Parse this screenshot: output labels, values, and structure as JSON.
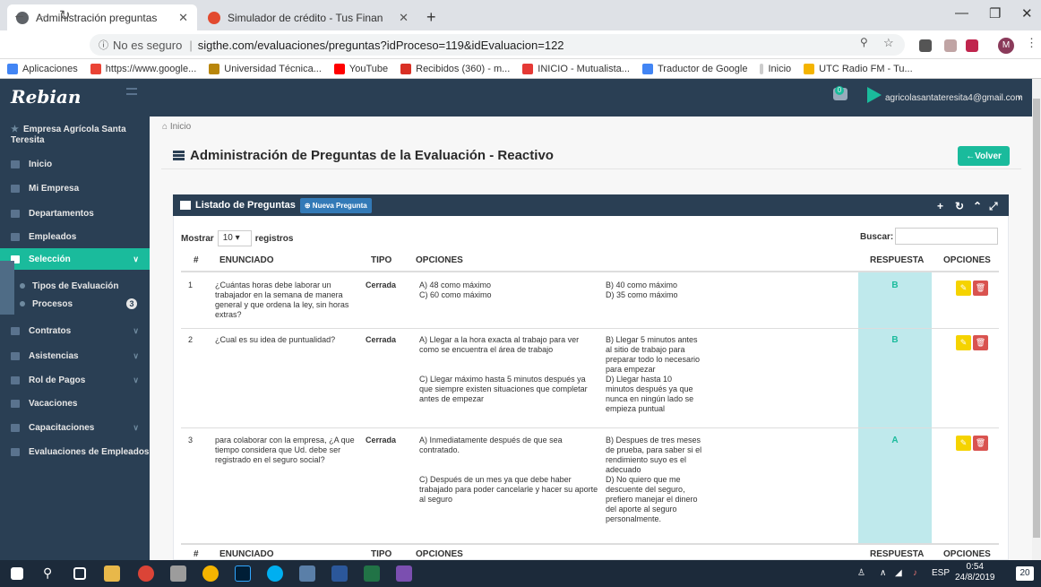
{
  "browser": {
    "tabs": [
      {
        "title": "Administración preguntas",
        "active": true
      },
      {
        "title": "Simulador de crédito - Tus Finan",
        "active": false
      }
    ],
    "security_label": "No es seguro",
    "url": "sigthe.com/evaluaciones/preguntas?idProceso=119&idEvaluacion=122",
    "profile_initial": "M",
    "bookmarks": [
      "Aplicaciones",
      "https://www.google...",
      "Universidad Técnica...",
      "YouTube",
      "Recibidos (360) - m...",
      "INICIO - Mutualista...",
      "Traductor de Google",
      "Inicio",
      "UTC Radio FM - Tu..."
    ]
  },
  "app": {
    "logo": "Rebian",
    "notification_count": "0",
    "user_email": "agricolasantateresita4@gmail.com",
    "company": "Empresa Agrícola Santa Teresita",
    "sidebar": [
      {
        "label": "Inicio",
        "icon": "home-icon"
      },
      {
        "label": "Mi Empresa",
        "icon": "building-icon"
      },
      {
        "label": "Departamentos",
        "icon": "building-icon"
      },
      {
        "label": "Empleados",
        "icon": "users-icon"
      },
      {
        "label": "Selección",
        "icon": "edit-icon",
        "active": true
      },
      {
        "label": "Contratos",
        "icon": "table-icon"
      },
      {
        "label": "Asistencias",
        "icon": "edit-icon"
      },
      {
        "label": "Rol de Pagos",
        "icon": "table-icon"
      },
      {
        "label": "Vacaciones",
        "icon": "plane-icon"
      },
      {
        "label": "Capacitaciones",
        "icon": "table-icon"
      },
      {
        "label": "Evaluaciones de Empleados",
        "icon": "table-icon"
      }
    ],
    "submenu": [
      {
        "label": "Tipos de Evaluación"
      },
      {
        "label": "Procesos",
        "badge": "3"
      }
    ]
  },
  "page": {
    "breadcrumb": "Inicio",
    "title": "Administración de Preguntas de la Evaluación - Reactivo",
    "back_label": "Volver",
    "panel_title": "Listado de Preguntas",
    "new_button": "Nueva Pregunta",
    "show_label": "Mostrar",
    "show_value": "10",
    "records_label": "registros",
    "search_label": "Buscar:",
    "columns": [
      "#",
      "ENUNCIADO",
      "TIPO",
      "OPCIONES",
      "RESPUESTA",
      "OPCIONES"
    ],
    "rows": [
      {
        "num": "1",
        "statement": "¿Cuántas horas debe laborar un trabajador en la semana de manera general y que ordena la ley, sin horas extras?",
        "type": "Cerrada",
        "opt_left": "A) 48 como máximo\nC) 60 como máximo",
        "opt_right": "B) 40 como máximo\nD) 35 como máximo",
        "answer": "B"
      },
      {
        "num": "2",
        "statement": "¿Cual es su idea de puntualidad?",
        "type": "Cerrada",
        "opt_left": "A) Llegar a la hora exacta al trabajo para ver como se encuentra el área de trabajo\n\n\nC) Llegar máximo hasta 5 minutos después ya que siempre existen situaciones que completar antes de empezar",
        "opt_right": "B) Llegar 5 minutos antes al sitio de trabajo para preparar todo lo necesario para empezar\nD) Llegar hasta 10 minutos después ya que nunca en ningún lado se empieza puntual",
        "answer": "B"
      },
      {
        "num": "3",
        "statement": "para colaborar con la empresa, ¿A que tiempo considera que Ud. debe ser registrado en el seguro social?",
        "type": "Cerrada",
        "opt_left": "A) Inmediatamente después de que sea contratado.\n\n\nC) Después de un mes ya que debe haber trabajado para poder cancelarle y hacer su aporte al seguro",
        "opt_right": "B) Despues de tres meses de prueba, para saber si el rendimiento suyo es el adecuado\nD) No quiero que me descuente del seguro, prefiero manejar el dinero del aporte al seguro personalmente.",
        "answer": "A"
      }
    ]
  },
  "taskbar": {
    "lang": "ESP",
    "time": "0:54",
    "date": "24/8/2019",
    "notif_count": "20"
  },
  "colors": {
    "sidebar": "#2a3f54",
    "accent": "#1abb9c",
    "answer_bg": "#bfe9ec",
    "edit_button": "#f5d300",
    "delete_button": "#d9534f"
  }
}
